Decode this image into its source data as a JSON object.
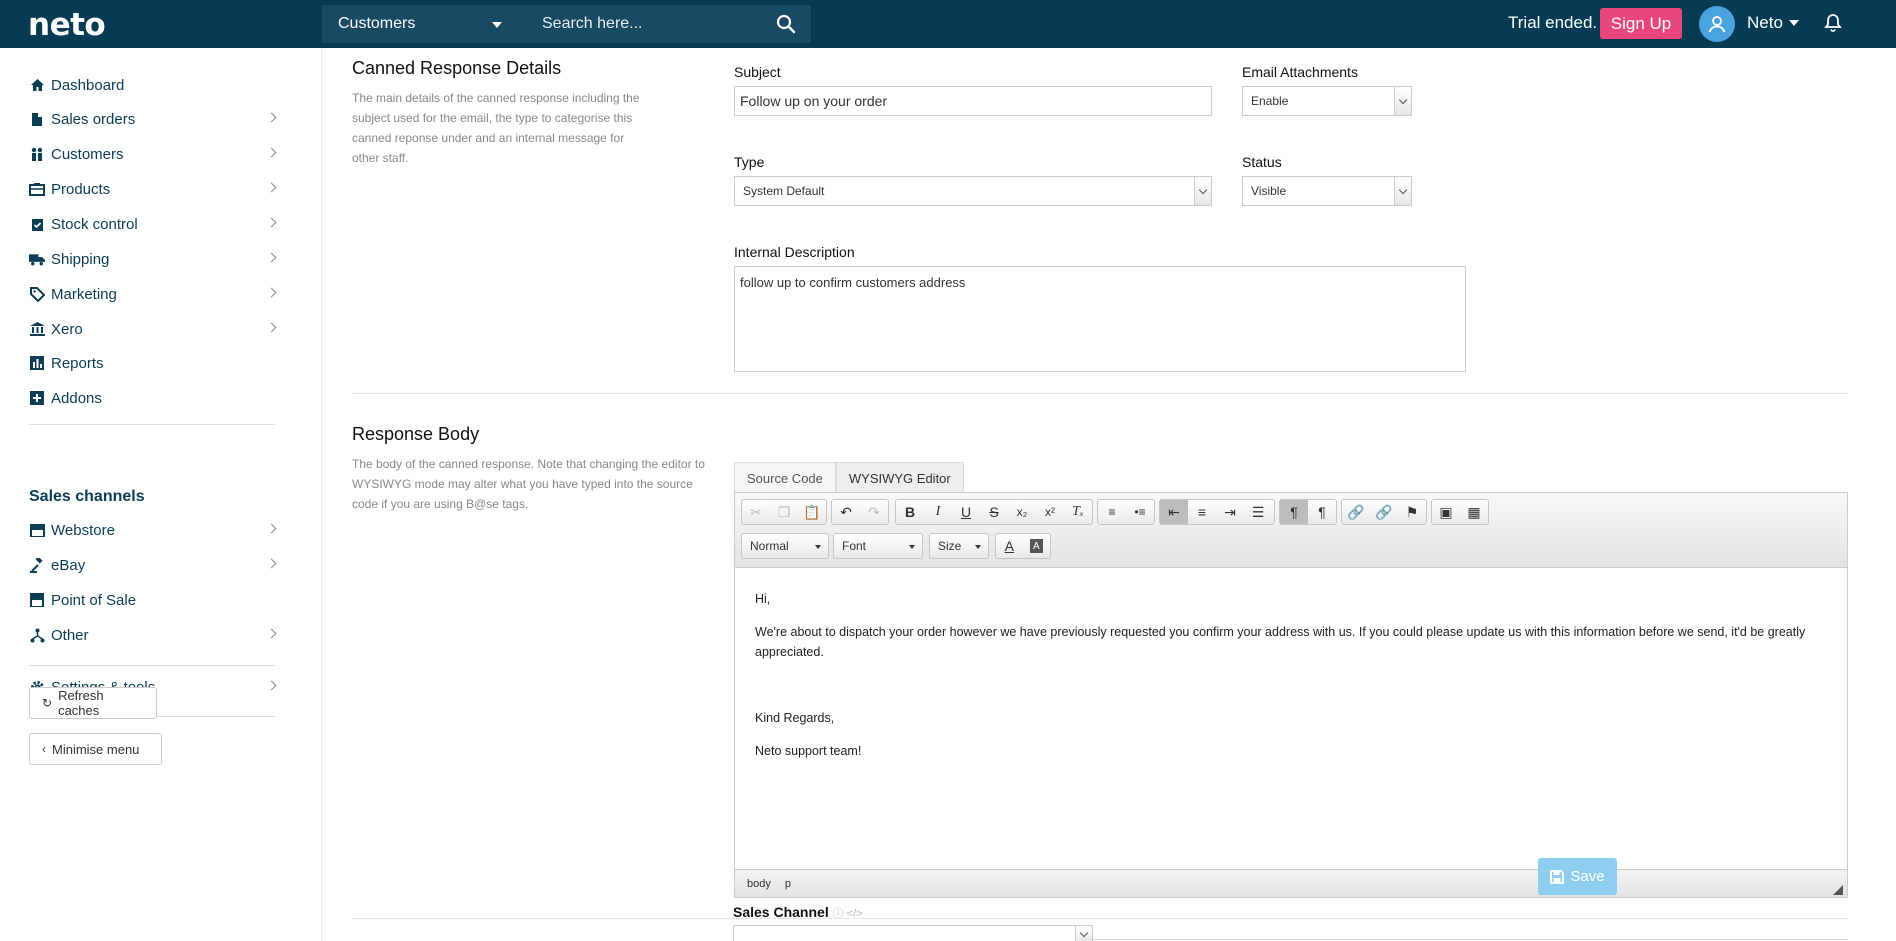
{
  "app": {
    "logo": "neto"
  },
  "topbar": {
    "search_scope": "Customers",
    "search_placeholder": "Search here...",
    "trial_text": "Trial ended.",
    "signup_label": "Sign Up",
    "user_name": "Neto"
  },
  "sidebar": {
    "items": [
      {
        "label": "Dashboard",
        "icon": "home-icon"
      },
      {
        "label": "Sales orders",
        "icon": "document-icon"
      },
      {
        "label": "Customers",
        "icon": "people-icon"
      },
      {
        "label": "Products",
        "icon": "box-icon"
      },
      {
        "label": "Stock control",
        "icon": "clipboard-icon"
      },
      {
        "label": "Shipping",
        "icon": "truck-icon"
      },
      {
        "label": "Marketing",
        "icon": "tag-icon"
      },
      {
        "label": "Xero",
        "icon": "bank-icon"
      },
      {
        "label": "Reports",
        "icon": "chart-icon"
      },
      {
        "label": "Addons",
        "icon": "plus-square-icon"
      }
    ],
    "channels_title": "Sales channels",
    "channels": [
      {
        "label": "Webstore",
        "icon": "store-icon"
      },
      {
        "label": "eBay",
        "icon": "gavel-icon"
      },
      {
        "label": "Point of Sale",
        "icon": "register-icon"
      },
      {
        "label": "Other",
        "icon": "network-icon"
      }
    ],
    "settings_label": "Settings & tools",
    "refresh_label": "Refresh caches",
    "minimise_label": "Minimise menu"
  },
  "details": {
    "title": "Canned Response Details",
    "description": "The main details of the canned response including the subject used for the email, the type to categorise this canned reponse under and an internal message for other staff.",
    "subject_label": "Subject",
    "subject_value": "Follow up on your order",
    "attachments_label": "Email Attachments",
    "attachments_value": "Enable",
    "type_label": "Type",
    "type_value": "System Default",
    "status_label": "Status",
    "status_value": "Visible",
    "internal_label": "Internal Description",
    "internal_value": "follow up to confirm customers address"
  },
  "body": {
    "title": "Response Body",
    "description": "The body of the canned response. Note that changing the editor to WYSIWYG mode may alter what you have typed into the source code if you are using B@se tags.",
    "tabs": [
      "Source Code",
      "WYSIWYG Editor"
    ],
    "format_value": "Normal",
    "font_value": "Font",
    "size_value": "Size",
    "paragraphs": [
      "Hi,",
      "We're about to dispatch your order however we have previously requested you confirm your address with us. If you could please update us with this information before we send, it'd be greatly appreciated.",
      "",
      "Kind Regards,",
      "Neto support team!"
    ],
    "path": [
      "body",
      "p"
    ]
  },
  "footer": {
    "save_label": "Save",
    "sales_channel_label": "Sales Channel"
  }
}
